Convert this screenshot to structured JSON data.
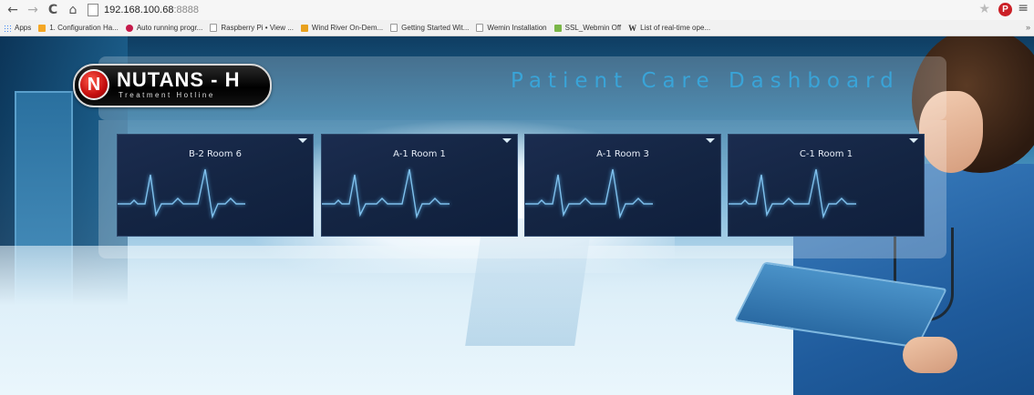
{
  "browser": {
    "nav": {
      "back_glyph": "←",
      "forward_glyph": "→",
      "reload_glyph": "C",
      "home_glyph": "⌂"
    },
    "url": {
      "host": "192.168.100.68",
      "port": ":8888"
    },
    "icons": [
      "back-icon",
      "forward-icon",
      "reload-icon",
      "home-icon",
      "page-icon",
      "star-icon",
      "pinterest-icon",
      "menu-icon"
    ],
    "bookmarks": [
      {
        "label": "Apps",
        "icon": "apps"
      },
      {
        "label": "1. Configuration Ha...",
        "icon": "cfg"
      },
      {
        "label": "Auto running progr...",
        "icon": "rpi"
      },
      {
        "label": "Raspberry Pi • View ...",
        "icon": "doc"
      },
      {
        "label": "Wind River On-Dem...",
        "icon": "wr"
      },
      {
        "label": "Getting Started Wit...",
        "icon": "doc"
      },
      {
        "label": "Wemin Installation",
        "icon": "doc"
      },
      {
        "label": "SSL_Webmin Off",
        "icon": "ssl"
      },
      {
        "label": "List of real-time ope...",
        "icon": "wiki"
      }
    ],
    "bookmarks_more": "»"
  },
  "logo": {
    "mark": "N",
    "title": "NUTANS - H",
    "subtitle": "Treatment Hotline"
  },
  "dashboard": {
    "title": "Patient Care Dashboard",
    "accent_color": "#39a4d8",
    "tiles": [
      {
        "label": "B-2 Room 6"
      },
      {
        "label": "A-1 Room 1"
      },
      {
        "label": "A-1 Room 3"
      },
      {
        "label": "C-1 Room 1"
      }
    ]
  }
}
